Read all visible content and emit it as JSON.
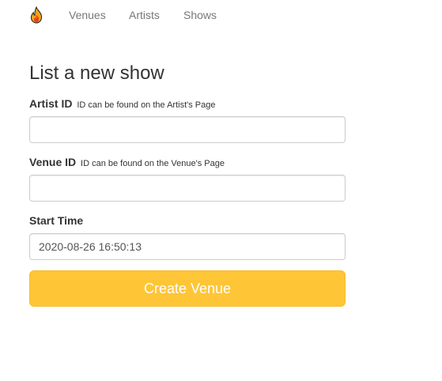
{
  "nav": {
    "brand_icon": "fire-icon",
    "links": [
      {
        "label": "Venues"
      },
      {
        "label": "Artists"
      },
      {
        "label": "Shows"
      }
    ]
  },
  "form": {
    "title": "List a new show",
    "artist_id": {
      "label": "Artist ID",
      "hint": "ID can be found on the Artist's Page",
      "value": ""
    },
    "venue_id": {
      "label": "Venue ID",
      "hint": "ID can be found on the Venue's Page",
      "value": ""
    },
    "start_time": {
      "label": "Start Time",
      "value": "2020-08-26 16:50:13"
    },
    "submit_label": "Create Venue"
  },
  "colors": {
    "submit_bg": "#fec537",
    "nav_link": "#777777"
  }
}
